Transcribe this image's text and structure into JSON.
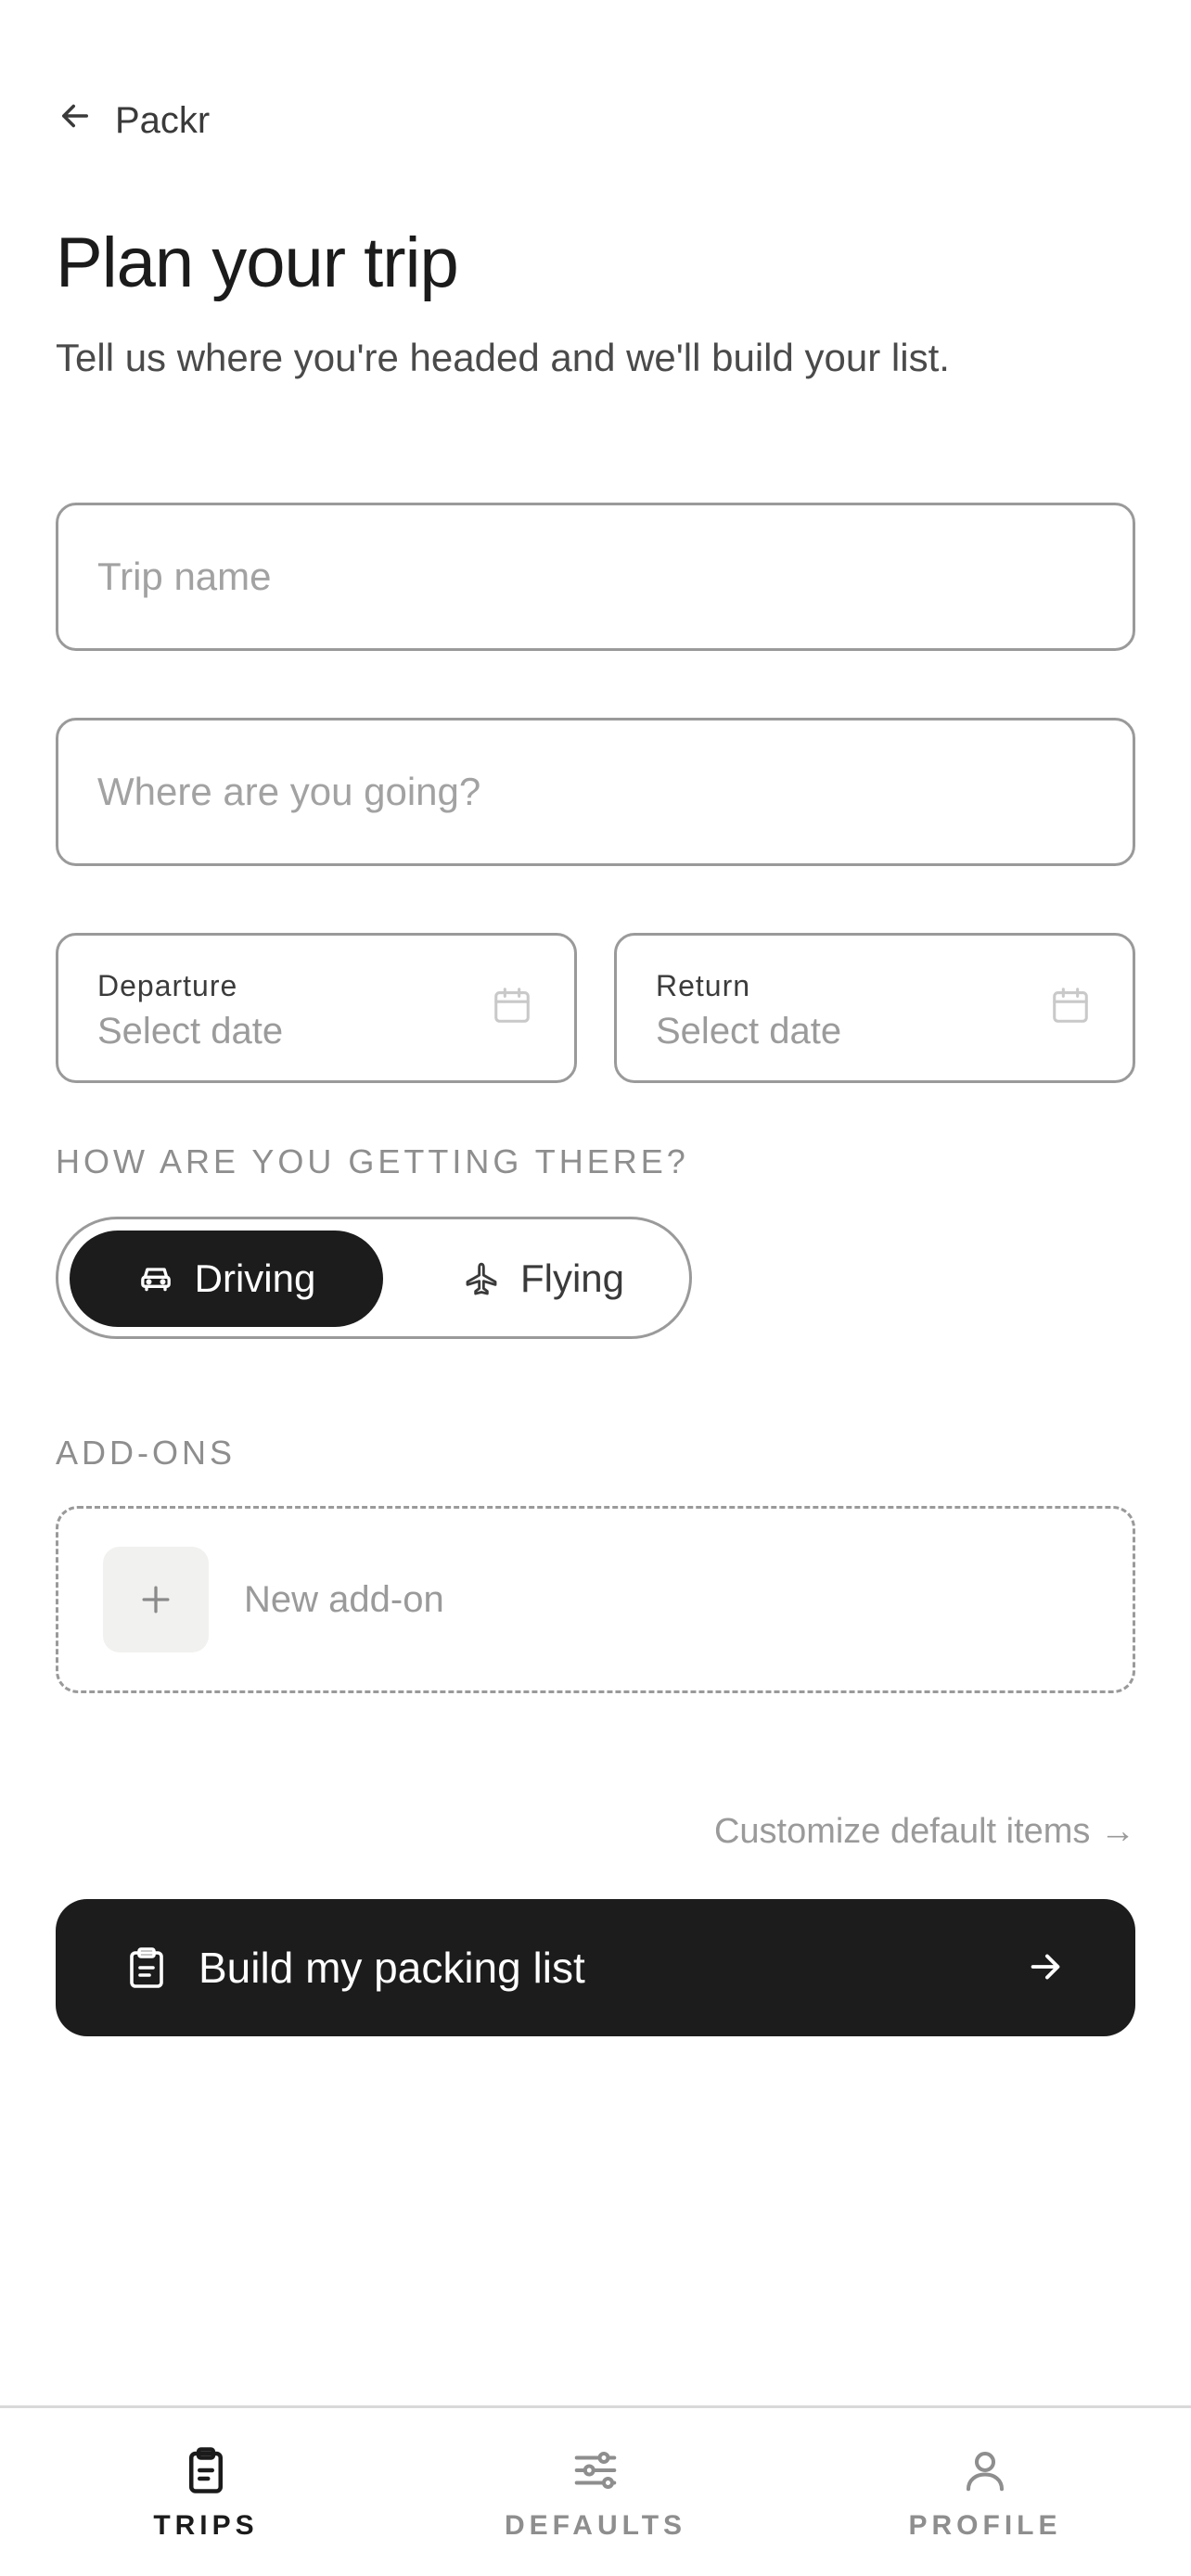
{
  "header": {
    "back_label": "Packr",
    "title": "Plan your trip",
    "subtitle": "Tell us where you're headed and we'll build your list."
  },
  "form": {
    "trip_name": {
      "value": "",
      "placeholder": "Trip name"
    },
    "destination": {
      "value": "",
      "placeholder": "Where are you going?"
    },
    "departure": {
      "label": "Departure",
      "value": "Select date"
    },
    "return": {
      "label": "Return",
      "value": "Select date"
    }
  },
  "transport": {
    "heading": "HOW ARE YOU GETTING THERE?",
    "options": [
      {
        "label": "Driving",
        "icon": "car-icon",
        "selected": true
      },
      {
        "label": "Flying",
        "icon": "plane-icon",
        "selected": false
      }
    ]
  },
  "addons": {
    "heading": "ADD-ONS",
    "new_label": "New add-on"
  },
  "customize_link": "Customize default items →",
  "cta": {
    "label": "Build my packing list"
  },
  "tabbar": {
    "items": [
      {
        "label": "TRIPS",
        "icon": "clipboard-icon",
        "active": true
      },
      {
        "label": "DEFAULTS",
        "icon": "sliders-icon",
        "active": false
      },
      {
        "label": "PROFILE",
        "icon": "person-icon",
        "active": false
      }
    ]
  },
  "colors": {
    "primary": "#1c1c1c",
    "border": "#9a9a9a",
    "muted_text": "#9a9a9a",
    "background": "#ffffff"
  }
}
